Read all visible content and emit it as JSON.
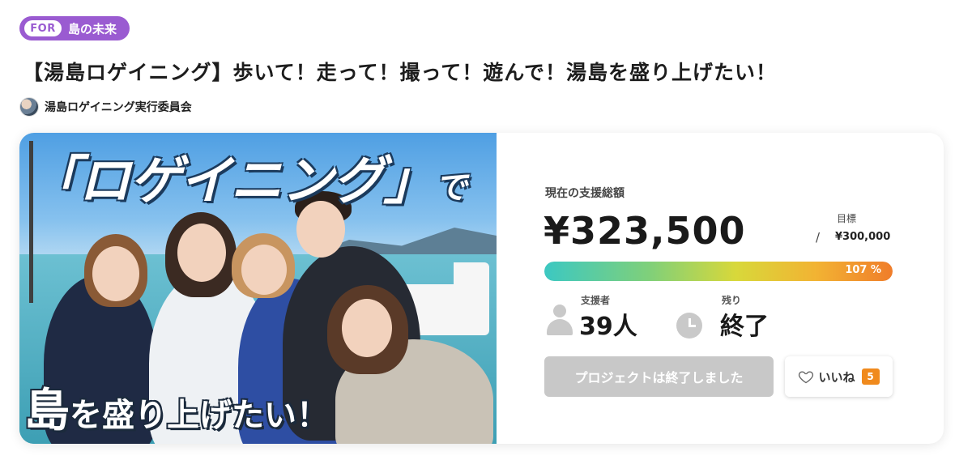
{
  "tag": {
    "prefix": "FOR",
    "label": "島の未来"
  },
  "title": "【湯島ロゲイニング】歩いて！走って！撮って！遊んで！湯島を盛り上げたい！",
  "owner": {
    "name": "湯島ロゲイニング実行委員会"
  },
  "hero": {
    "top_text": "「ロゲイニング」",
    "top_text_suffix": "で",
    "bottom_text_main": "島",
    "bottom_text_rest": "を盛り上げたい！"
  },
  "funding": {
    "amount_label": "現在の支援総額",
    "amount": "¥323,500",
    "goal_label": "目標",
    "goal_slash": "/",
    "goal_value": "¥300,000",
    "progress_percent": 107,
    "progress_text": "107 %"
  },
  "stats": {
    "supporters_label": "支援者",
    "supporters_value": "39人",
    "remaining_label": "残り",
    "remaining_value": "終了"
  },
  "actions": {
    "ended_label": "プロジェクトは終了しました",
    "like_label": "いいね",
    "like_count": "5"
  },
  "colors": {
    "tag_purple": "#9a5bd1",
    "like_badge": "#f08a1d",
    "disabled_button": "#c8c8c8"
  }
}
